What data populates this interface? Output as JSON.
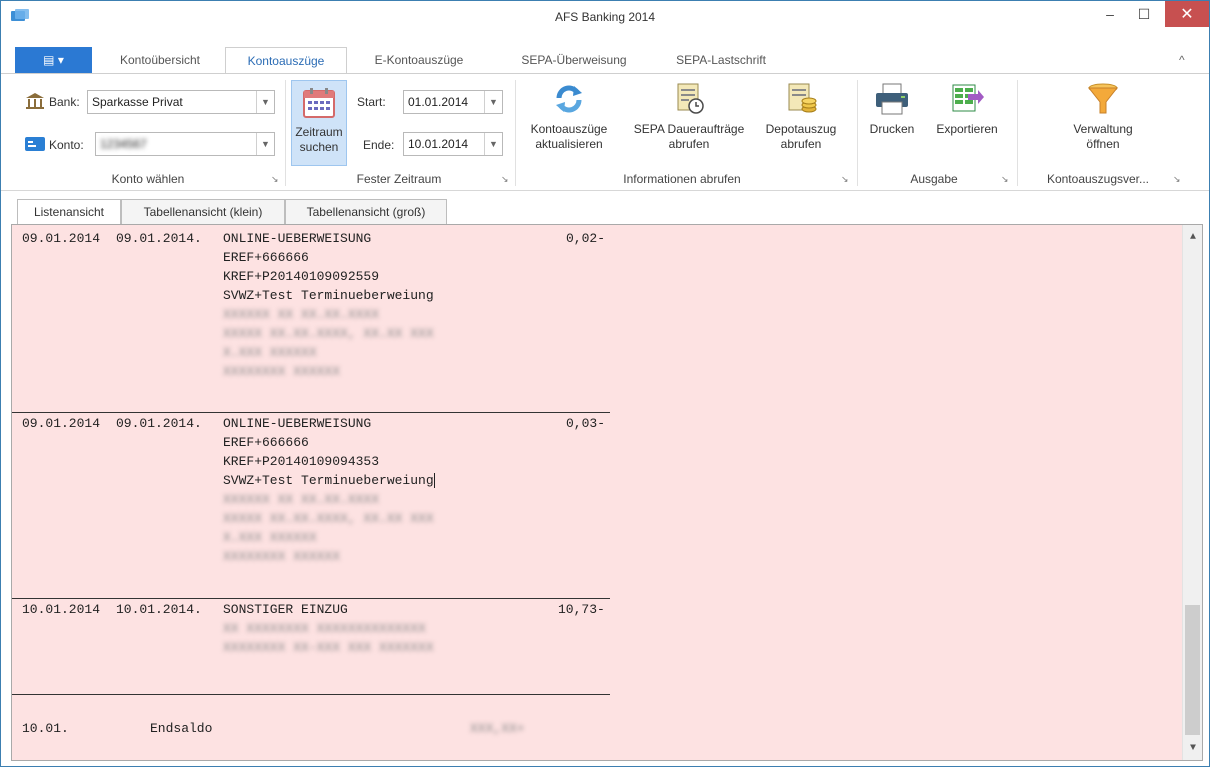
{
  "window": {
    "title": "AFS Banking 2014",
    "minimize": "–",
    "maximize": "☐",
    "close": "✕"
  },
  "ribbon_tabs": {
    "file": "▤ ▾",
    "tabs": [
      "Kontoübersicht",
      "Kontoauszüge",
      "E-Kontoauszüge",
      "SEPA-Überweisung",
      "SEPA-Lastschrift"
    ],
    "active": "Kontoauszüge",
    "collapse": "^"
  },
  "konto_group": {
    "bank_label": "Bank:",
    "bank_value": "Sparkasse Privat",
    "konto_label": "Konto:",
    "konto_value": "1234567",
    "group_label": "Konto wählen"
  },
  "zeitraum_group": {
    "search_button": "Zeitraum\nsuchen",
    "start_label": "Start:",
    "start_value": "01.01.2014",
    "end_label": "Ende:",
    "end_value": "10.01.2014",
    "group_label": "Fester Zeitraum"
  },
  "info_group": {
    "refresh_button": "Kontoauszüge\naktualisieren",
    "standing_orders_button": "SEPA Daueraufträge\nabrufen",
    "depot_button": "Depotauszug\nabrufen",
    "group_label": "Informationen abrufen"
  },
  "output_group": {
    "print_button": "Drucken",
    "export_button": "Exportieren",
    "group_label": "Ausgabe"
  },
  "admin_group": {
    "manage_button": "Verwaltung\nöffnen",
    "group_label": "Kontoauszugsver..."
  },
  "view_tabs": [
    "Listenansicht",
    "Tabellenansicht (klein)",
    "Tabellenansicht (groß)"
  ],
  "transactions": [
    {
      "booking": "09.01.2014",
      "value_date": "09.01.2014.",
      "type": "ONLINE-UEBERWEISUNG",
      "amount": "0,02-",
      "details": [
        "EREF+666666",
        "KREF+P20140109092559",
        "SVWZ+Test Terminueberweiung"
      ],
      "hidden": [
        "XXXXXX XX XX.XX.XXXX",
        "XXXXX XX.XX.XXXX, XX.XX XXX",
        "X.XXX XXXXXX",
        "XXXXXXXX XXXXXX"
      ]
    },
    {
      "booking": "09.01.2014",
      "value_date": "09.01.2014.",
      "type": "ONLINE-UEBERWEISUNG",
      "amount": "0,03-",
      "details": [
        "EREF+666666",
        "KREF+P20140109094353",
        "SVWZ+Test Terminueberweiung"
      ],
      "hidden": [
        "XXXXXX XX XX.XX.XXXX",
        "XXXXX XX.XX.XXXX, XX.XX XXX",
        "X.XXX XXXXXX",
        "XXXXXXXX XXXXXX"
      ]
    },
    {
      "booking": "10.01.2014",
      "value_date": "10.01.2014.",
      "type": "SONSTIGER EINZUG",
      "amount": "10,73-",
      "details": [],
      "hidden": [
        "XX XXXXXXXX XXXXXXXXXXXXXX",
        "XXXXXXXX XX-XXX XXX XXXXXXX"
      ]
    }
  ],
  "closing": {
    "date": "10.01.",
    "label": "Endsaldo",
    "amount": "XXX,XX+"
  }
}
